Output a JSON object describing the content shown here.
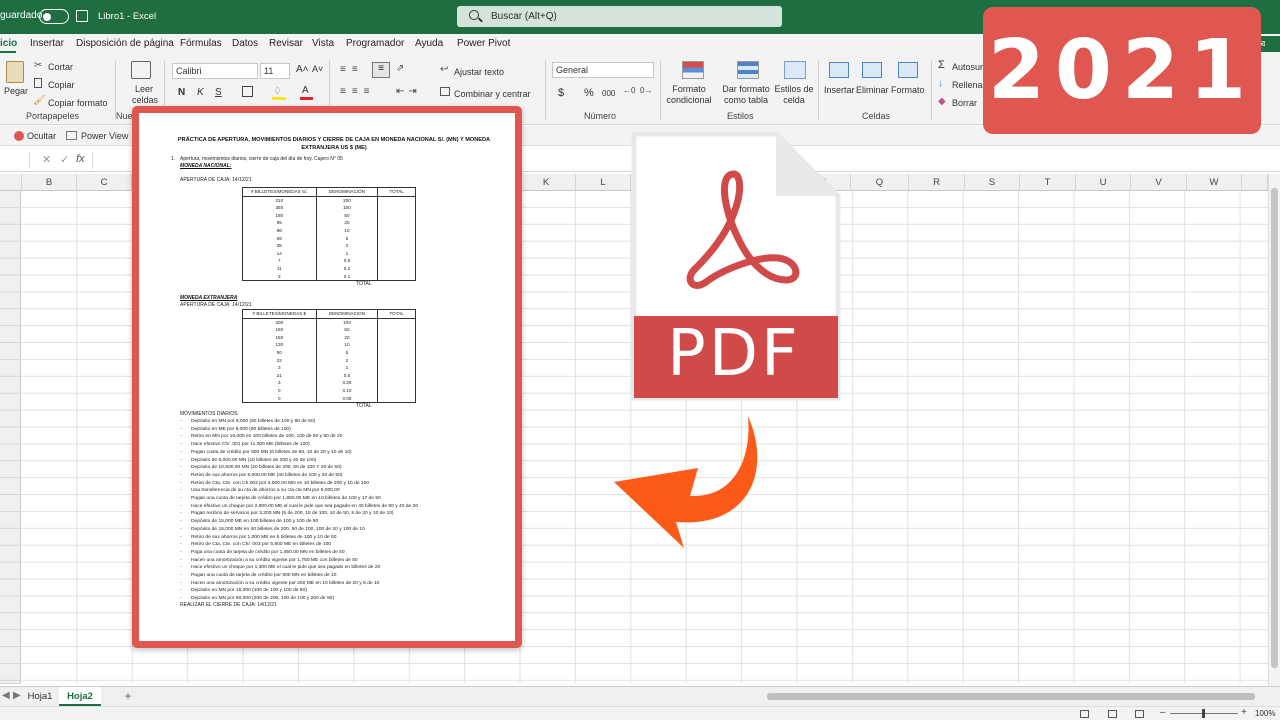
{
  "titlebar": {
    "autosave_label": "guardado",
    "file_title": "Libro1  -  Excel",
    "search_placeholder": "Buscar (Alt+Q)"
  },
  "menu": {
    "items": [
      "Inicio",
      "Insertar",
      "Disposición de página",
      "Fórmulas",
      "Datos",
      "Revisar",
      "Vista",
      "Programador",
      "Ayuda",
      "Power Pivot"
    ],
    "active_display": "icio"
  },
  "ribbon": {
    "paste": "Pegar",
    "cut": "Cortar",
    "copy": "Copiar",
    "format_painter": "Copiar formato",
    "clipboard_group": "Portapapeles",
    "nuevo_group": "Nuevo",
    "read_cells": "Leer celdas",
    "font_name": "Calibri",
    "font_size": "11",
    "bold": "N",
    "italic": "K",
    "underline": "S",
    "wrap_text": "Ajustar texto",
    "merge_center": "Combinar y centrar",
    "number_format": "General",
    "number_group": "Número",
    "currency": "$",
    "percent": "%",
    "thousands": "000",
    "cond_format": "Formato condicional",
    "table_format": "Dar formato como tabla",
    "cell_styles": "Estilos de celda",
    "styles_group": "Estilos",
    "insert": "Insertar",
    "delete": "Eliminar",
    "format": "Formato",
    "cells_group": "Celdas",
    "autosum": "Autosum",
    "fill": "Rellenar",
    "clear": "Borrar"
  },
  "row2": {
    "hide": "Ocultar",
    "power_view": "Power View"
  },
  "formula": {
    "fx": "fx"
  },
  "columns": [
    "B",
    "C",
    "D",
    "E",
    "F",
    "G",
    "H",
    "I",
    "J",
    "K",
    "L",
    "M",
    "N",
    "O",
    "P",
    "Q",
    "R",
    "S",
    "T",
    "U",
    "V",
    "W"
  ],
  "sheets": {
    "tabs": [
      "Hoja1",
      "Hoja2"
    ],
    "active": "Hoja2",
    "add": "+"
  },
  "status": {
    "zoom": "100%"
  },
  "badge": {
    "year": "2021"
  },
  "pdf_icon": {
    "label": "PDF"
  },
  "doc": {
    "title": "PRÁCTICA DE APERTURA, MOVIMIENTOS DIARIOS Y CIERRE DE CAJA EN MONEDA NACIONAL S/. (MN) Y MONEDA EXTRANJERA US $ (ME)",
    "item_number": "1.",
    "intro": "Apertura, movimientos diarios, cierre de caja del día de hoy. Cajero N° 05",
    "mn_heading": "MONEDA NACIONAL:",
    "mn_opening": "APERTURA DE CAJA:  14/12/21",
    "mn_headers": [
      "# BILLETES/MONEDAS S/.",
      "DENOMINACIÓN",
      "TOTAL"
    ],
    "mn_rows": [
      [
        "210",
        "200"
      ],
      [
        "350",
        "100"
      ],
      [
        "180",
        "50"
      ],
      [
        "95",
        "20"
      ],
      [
        "98",
        "10"
      ],
      [
        "59",
        "5"
      ],
      [
        "35",
        "2"
      ],
      [
        "14",
        "1"
      ],
      [
        "7",
        "0.5"
      ],
      [
        "11",
        "0.2"
      ],
      [
        "3",
        "0.1"
      ]
    ],
    "mn_total": "TOTAL",
    "me_heading": "MONEDA EXTRANJERA",
    "me_opening": "APERTURA DE CAJA:  14/12/21",
    "me_headers": [
      "# BILLETES/MONEDAS  $",
      "DENOMINACIÓN",
      "TOTAL"
    ],
    "me_rows": [
      [
        "200",
        "100"
      ],
      [
        "160",
        "50"
      ],
      [
        "150",
        "20"
      ],
      [
        "130",
        "10"
      ],
      [
        "50",
        "5"
      ],
      [
        "22",
        "2"
      ],
      [
        "3",
        "1"
      ],
      [
        "21",
        "0.5"
      ],
      [
        "3",
        "0.25"
      ],
      [
        "0",
        "0.10"
      ],
      [
        "0",
        "0.05"
      ]
    ],
    "me_total": "TOTAL",
    "movements_heading": "MOVIMIENTOS DIARIOS:",
    "movements": [
      "Depósito en MN por 9,000 (50 billetes de 100 y 80 de 50)",
      "Depósito en ME por 9,000 (90 billetes de 100)",
      "Retiro en MN por 16,000 en 100 billetes de 100, 100 de 50 y 50 de 20",
      "Hace efectivo Ch/. 001 por 11,000 ME (billetes de 100)",
      "Pagan cuota de crédito por 600 MN (6 billetes de 50, 10 de 20 y 10 de 10)",
      "Depósito de 6,000.00 MN (10 billetes de 200 y 40 de 100)",
      "Depósito de 10,500.00 MN (20 billetes de 200, 60 de 100 Y 20 de 50)",
      "Retiro de sus ahorros por 5,000.00 ME (40 billetes de 100 y 20 de 50)",
      "Retiro de Cta. Cte. con Ch.002 por 3,000.00 MN en 10 billetes de 200 y 10 de 100",
      "Una transferencia de su cta de ahorros a su cta cte MN por 6,000.00",
      "Pagan una cuota de tarjeta de crédito por 1,850.00 ME en 10 billetes de 100 y 17 de 50",
      "Hace efectivo un cheque por 2,800.00 ME el cual le pide que sea pagado en 40 billetes de 50 y 40 de 20",
      "Pagan recibos de servicios por 3,200 MN (5 de 200, 15 de 100, 10 de 50, 5 de 20 y 10 de 10)",
      "Depósito de 15,000 ME en 100 billetes de 100 y 100 de 50",
      "Depósito de 16,000 MN en 40 billetes de 200, 50 de 100, 100 de 20 y 100 de 10",
      "Retiro de sus ahorros por 1,000 ME en 5 billetes de 100 y 10 de 50",
      "Retiro de Cta. Cte. con Ch/. 003 por 5,600 ME en billetes de 100",
      "Paga una cuota de tarjeta de crédito por 1,050.00 MN en billetes de 50",
      "Hacen una amortización a su crédito vigente por 1,750 ME con billetes de 50",
      "Hace efectivo un cheque por 1,300 ME el cual le pide que sea pagado en billetes de 20",
      "Pagan una cuota de tarjeta de crédito por 800 MN en billetes de 10",
      "Hacen una amortización a su crédito vigente por 250 ME en 10 billetes de 20 y 5 de 10",
      "Depósito en MN por 15,000 (100 de 100 y 100 de 50)",
      "Depósito en MN por 60,000 (200 de 200, 100 de 100 y 200 de 50)"
    ],
    "closing": "REALIZAR EL CIERRE DE CAJA: 14/12/21"
  }
}
